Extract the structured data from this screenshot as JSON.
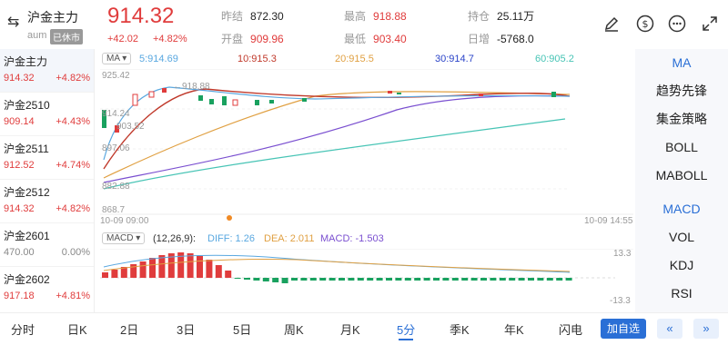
{
  "header": {
    "product_name": "沪金主力",
    "product_code": "aum",
    "status_badge": "已休市",
    "last_price": "914.32",
    "change": "+42.02",
    "change_pct": "+4.82%",
    "stats": {
      "prev_close_label": "昨结",
      "prev_close": "872.30",
      "open_label": "开盘",
      "open": "909.96",
      "high_label": "最高",
      "high": "918.88",
      "low_label": "最低",
      "low": "903.40",
      "oi_label": "持仓",
      "oi": "25.11万",
      "oi_change_label": "日增",
      "oi_change": "-5768.0"
    },
    "icons": [
      "draw-icon",
      "dollar-icon",
      "more-icon",
      "fullscreen-icon"
    ]
  },
  "contracts": [
    {
      "name": "沪金主力",
      "price": "914.32",
      "pct": "+4.82%",
      "trend": "up"
    },
    {
      "name": "沪金2510",
      "price": "909.14",
      "pct": "+4.43%",
      "trend": "up"
    },
    {
      "name": "沪金2511",
      "price": "912.52",
      "pct": "+4.74%",
      "trend": "up"
    },
    {
      "name": "沪金2512",
      "price": "914.32",
      "pct": "+4.82%",
      "trend": "up"
    },
    {
      "name": "沪金2601",
      "price": "470.00",
      "pct": "0.00%",
      "trend": "flat"
    },
    {
      "name": "沪金2602",
      "price": "917.18",
      "pct": "+4.81%",
      "trend": "up"
    }
  ],
  "ma_legend": {
    "selector": "MA",
    "ma5": "5:914.69",
    "ma10": "10:915.3",
    "ma20": "20:915.5",
    "ma30": "30:914.7",
    "ma60": "60:905.2"
  },
  "macd_legend": {
    "selector": "MACD",
    "params": "(12,26,9):",
    "diff": "DIFF: 1.26",
    "dea": "DEA: 2.011",
    "macd": "MACD: -1.503"
  },
  "chart_data": {
    "type": "candlestick",
    "price_axis": {
      "labels": [
        "925.42",
        "914.24",
        "903.52",
        "897.06",
        "882.88",
        "868.7"
      ],
      "high_marker": "918.88"
    },
    "time_axis": {
      "start": "10-09 09:00",
      "end": "10-09 14:55"
    },
    "macd_axis": {
      "max": "13.3",
      "min": "-13.3"
    },
    "colors": {
      "up": "#e03c3c",
      "down": "#19a15f",
      "ma5": "#5aa8e0",
      "ma10": "#c0392b",
      "ma20": "#e0a042",
      "ma30": "#7a4fd0",
      "ma60": "#47c4b5"
    }
  },
  "indicators": {
    "main": [
      "MA",
      "趋势先锋",
      "集金策略",
      "BOLL",
      "MABOLL"
    ],
    "sub": [
      "MACD",
      "VOL",
      "KDJ",
      "RSI"
    ]
  },
  "timeframes": [
    "分时",
    "日K",
    "2日",
    "3日",
    "5日",
    "周K",
    "月K",
    "5分",
    "季K",
    "年K",
    "闪电"
  ],
  "active_timeframe": "5分",
  "watchlist_label": "加自选",
  "nav": {
    "prev": "«",
    "next": "»"
  }
}
